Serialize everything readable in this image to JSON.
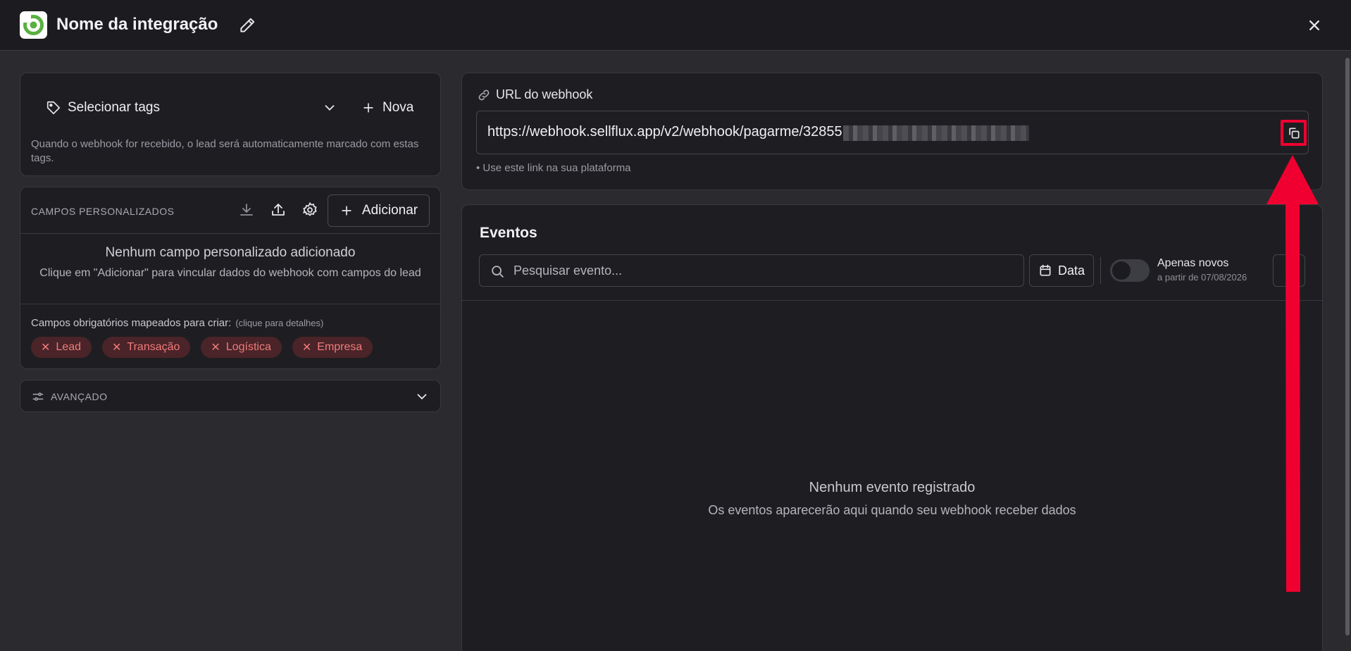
{
  "header": {
    "title": "Nome da integração",
    "logo_icon": "sellflux-logo",
    "edit_icon": "pencil-icon",
    "close_icon": "close-icon"
  },
  "tags": {
    "select_label": "Selecionar tags",
    "new_label": "Nova",
    "help_text": "Quando o webhook for recebido, o lead será automaticamente marcado com estas tags."
  },
  "custom_fields": {
    "title": "CAMPOS PERSONALIZADOS",
    "add_label": "Adicionar",
    "empty_title": "Nenhum campo personalizado adicionado",
    "empty_sub": "Clique em \"Adicionar\" para vincular dados do webhook com campos do lead",
    "required_label": "Campos obrigatórios mapeados para criar:",
    "required_hint": "(clique para detalhes)",
    "chips": [
      "Lead",
      "Transação",
      "Logística",
      "Empresa"
    ]
  },
  "advanced": {
    "label": "AVANÇADO"
  },
  "webhook": {
    "label": "URL do webhook",
    "url": "https://webhook.sellflux.app/v2/webhook/pagarme/32855",
    "note": "• Use este link na sua plataforma"
  },
  "events": {
    "title": "Eventos",
    "search_placeholder": "Pesquisar evento...",
    "date_label": "Data",
    "toggle_label": "Apenas novos",
    "toggle_sub": "a partir de 07/08/2026",
    "toggle_on": false,
    "empty_title": "Nenhum evento registrado",
    "empty_sub": "Os eventos aparecerão aqui quando seu webhook receber dados"
  },
  "colors": {
    "background": "#2a2a2f",
    "card": "#1e1e22",
    "accent_red": "#f00030",
    "chip_bg": "#4a2428",
    "chip_text": "#f07b7b",
    "logo_green": "#5bb040"
  }
}
